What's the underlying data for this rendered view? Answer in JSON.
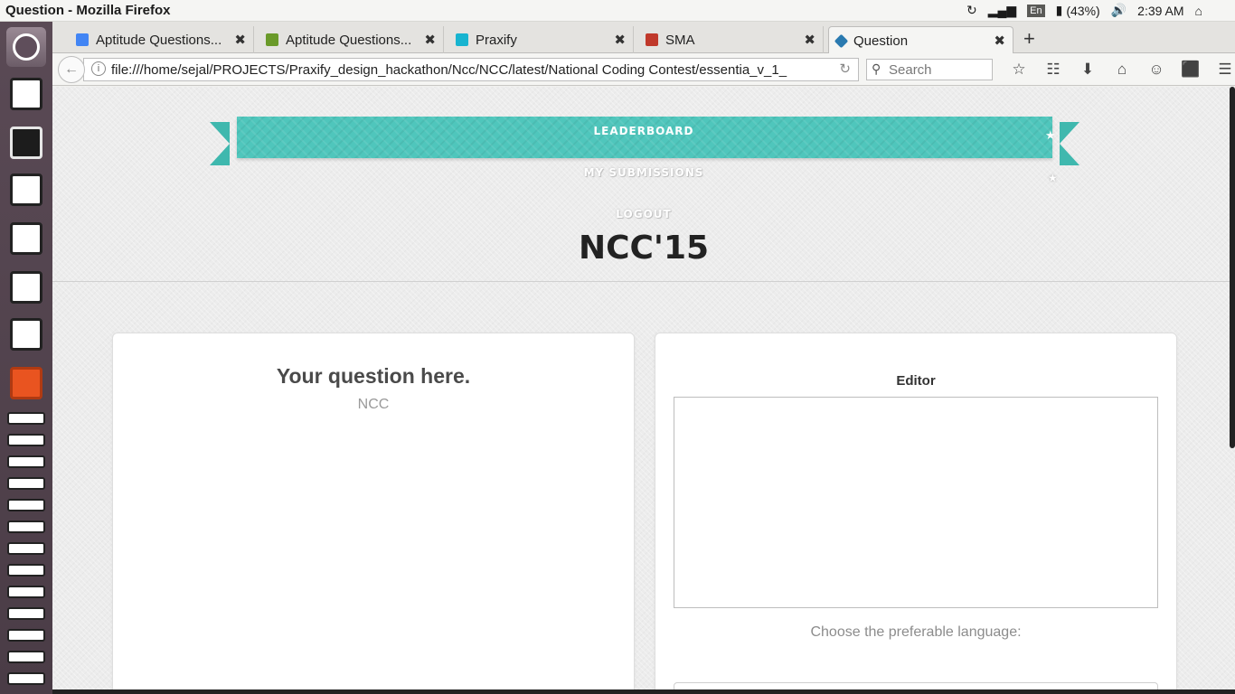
{
  "system": {
    "window_title": "Question - Mozilla Firefox",
    "battery": "(43%)",
    "time": "2:39 AM",
    "keyboard_layout": "En"
  },
  "browser": {
    "tabs": [
      {
        "label": "Aptitude Questions...",
        "favicon": "google-icon",
        "color": "#4285f4"
      },
      {
        "label": "Aptitude Questions...",
        "favicon": "leaf-icon",
        "color": "#6a9a2a"
      },
      {
        "label": "Praxify",
        "favicon": "praxify-icon",
        "color": "#18b4d0"
      },
      {
        "label": "SMA",
        "favicon": "sma-icon",
        "color": "#c0392b"
      },
      {
        "label": "Question",
        "favicon": "diamond-icon",
        "color": "#2a7ab0",
        "active": true
      }
    ],
    "url": "file:///home/sejal/PROJECTS/Praxify_design_hackathon/Ncc/NCC/latest/National Coding Contest/essentia_v_1_",
    "search_placeholder": "Search"
  },
  "page": {
    "nav": {
      "leaderboard": "LEADERBOARD",
      "my_submissions": "MY SUBMISSIONS",
      "logout": "LOGOUT"
    },
    "brand": "NCC'15",
    "question": {
      "title": "Your question here.",
      "subtitle": "NCC"
    },
    "editor": {
      "title": "Editor",
      "value": "",
      "language_label": "Choose the preferable language:"
    }
  },
  "colors": {
    "ribbon": "#4fc6bc",
    "ribbon_tail": "#3fb8ae"
  }
}
